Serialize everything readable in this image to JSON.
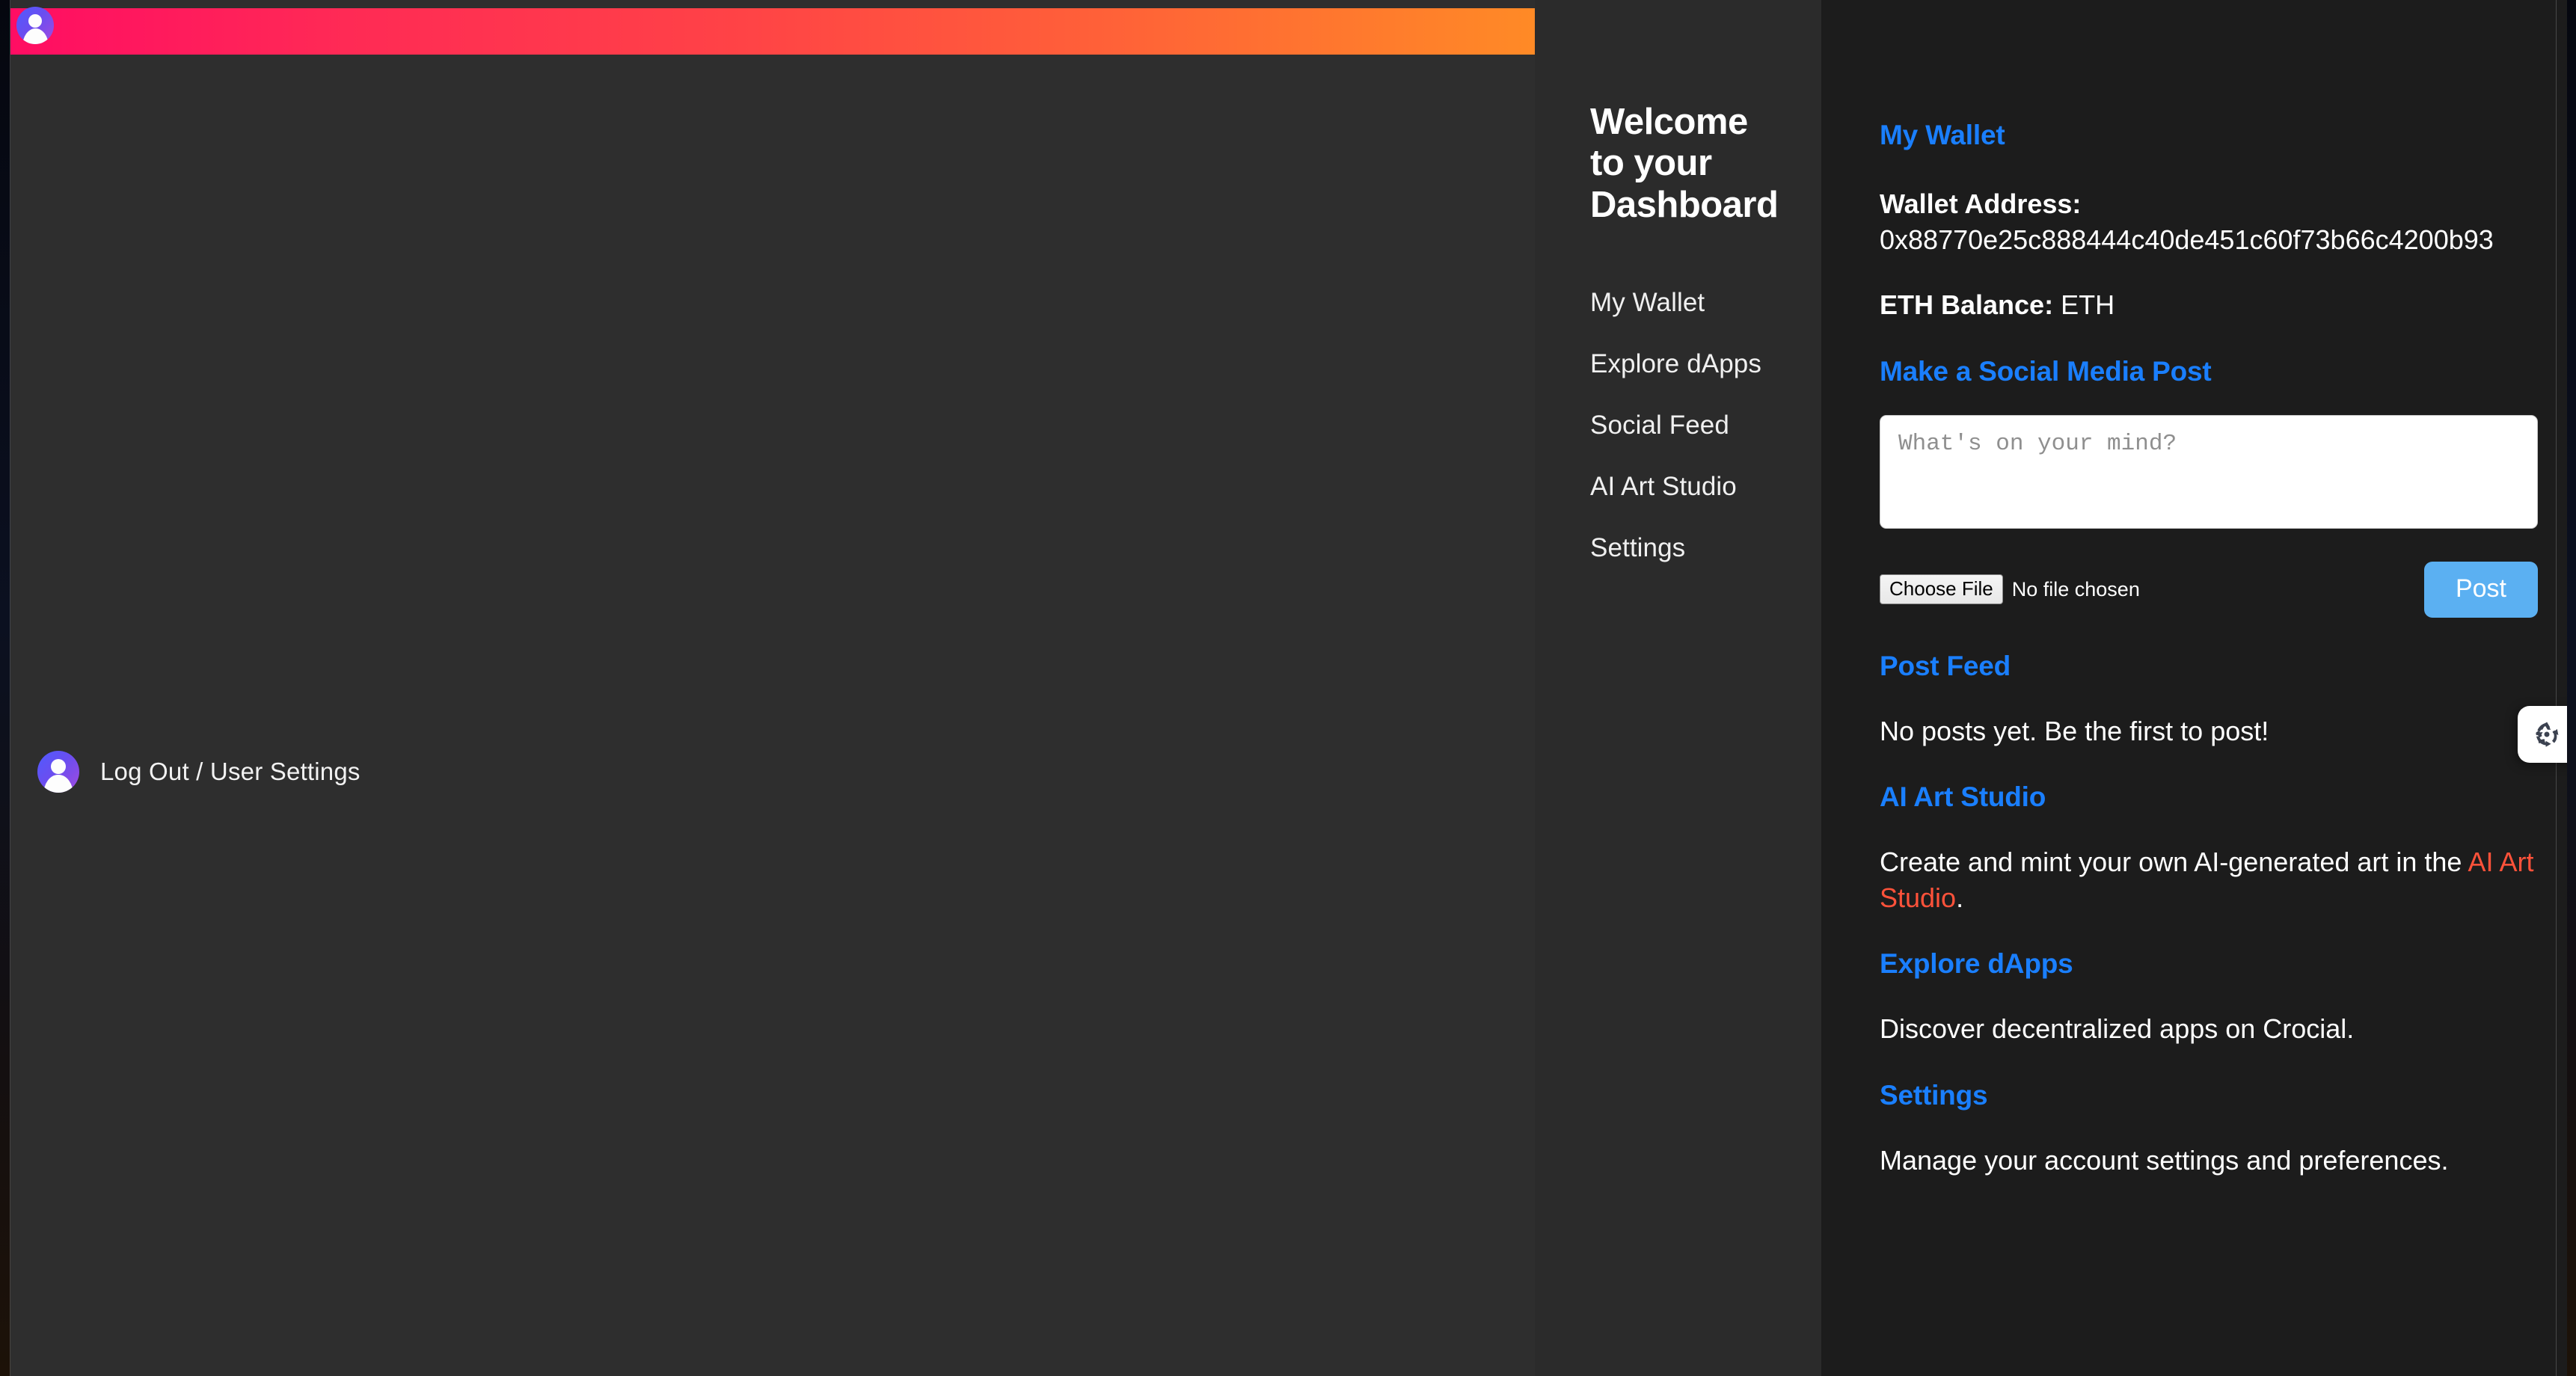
{
  "banner": {
    "gradient_start": "#ff0d63",
    "gradient_end": "#ff8a26",
    "avatar_icon": "user-avatar-icon"
  },
  "left_panel": {
    "user_menu_label": "Log Out / User Settings",
    "avatar_icon": "user-avatar-icon"
  },
  "sidebar": {
    "title": "Welcome to your Dashboard",
    "items": [
      {
        "label": "My Wallet"
      },
      {
        "label": "Explore dApps"
      },
      {
        "label": "Social Feed"
      },
      {
        "label": "AI Art Studio"
      },
      {
        "label": "Settings"
      }
    ]
  },
  "content": {
    "wallet": {
      "heading": "My Wallet",
      "address_label": "Wallet Address:",
      "address_value": "0x88770e25c888444c40de451c60f73b66c4200b93",
      "balance_label": "ETH Balance:",
      "balance_value": "ETH"
    },
    "social_post": {
      "heading": "Make a Social Media Post",
      "textarea_placeholder": "What's on your mind?",
      "file_button_label": "Choose File",
      "file_status": "No file chosen",
      "post_button_label": "Post"
    },
    "post_feed": {
      "heading": "Post Feed",
      "empty_message": "No posts yet. Be the first to post!"
    },
    "ai_art_studio": {
      "heading": "AI Art Studio",
      "body_prefix": "Create and mint your own AI-generated art in the ",
      "link_text": "AI Art Studio",
      "body_suffix": ".",
      "link_color": "#ff523a"
    },
    "explore_dapps": {
      "heading": "Explore dApps",
      "body": "Discover decentralized apps on Crocial."
    },
    "settings": {
      "heading": "Settings",
      "body": "Manage your account settings and preferences."
    },
    "heading_color": "#1a7fff"
  },
  "floating_widget": {
    "icon": "recycle-arrows-icon"
  }
}
